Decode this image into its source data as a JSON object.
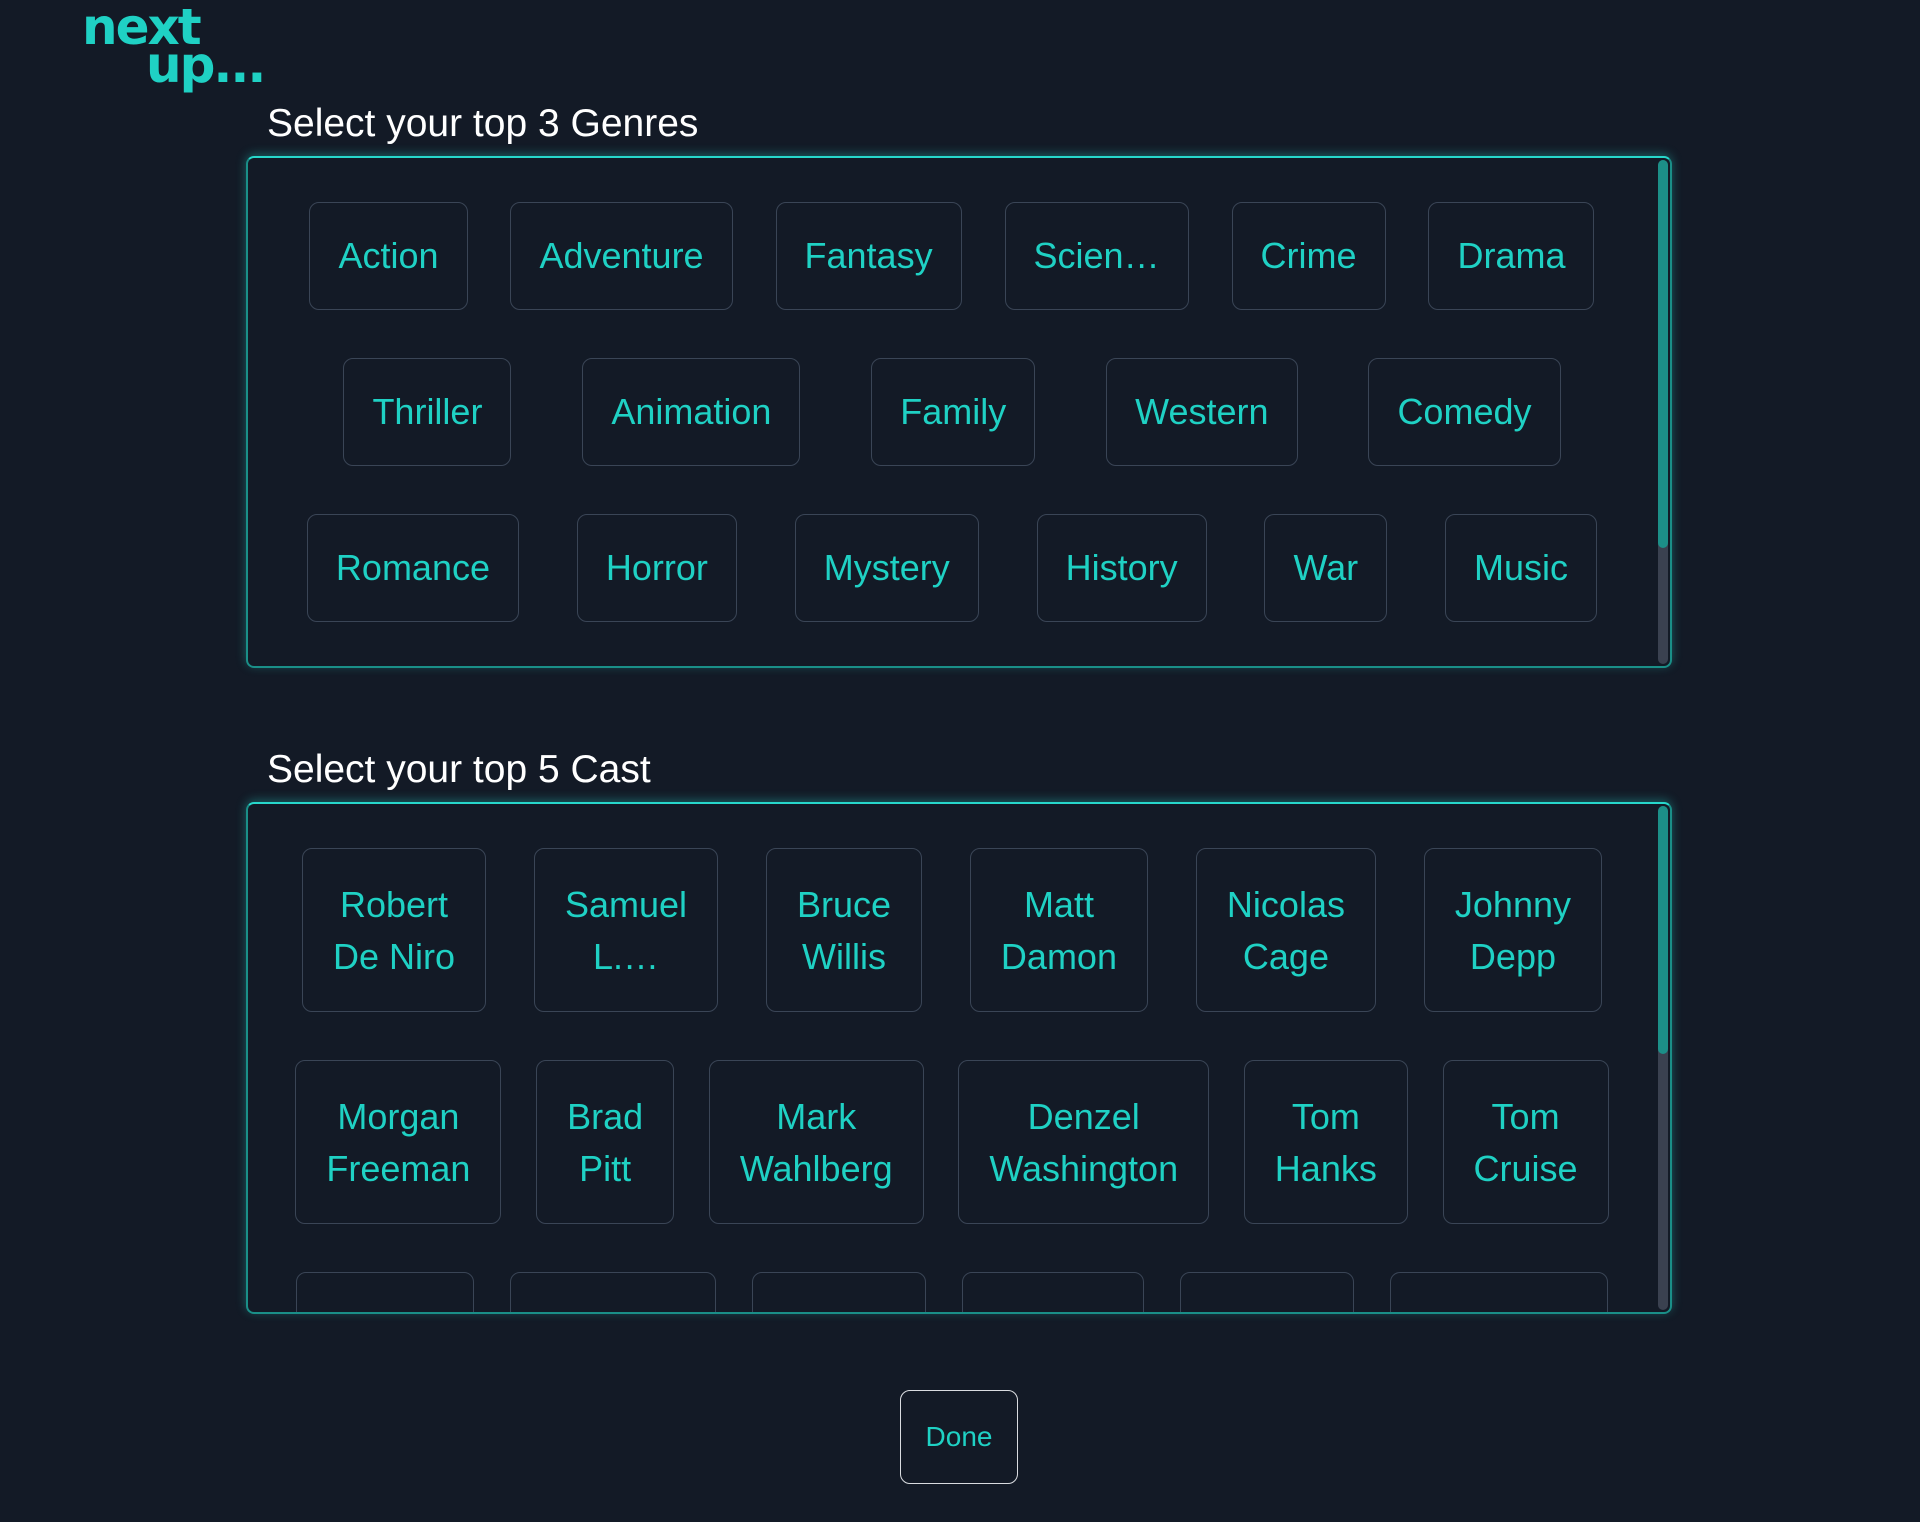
{
  "logo": {
    "line1": "next",
    "line2": "up..."
  },
  "genres": {
    "title": "Select your top 3 Genres",
    "rows": [
      [
        "Action",
        "Adventure",
        "Fantasy",
        "Scien…",
        "Crime",
        "Drama"
      ],
      [
        "Thriller",
        "Animation",
        "Family",
        "Western",
        "Comedy"
      ],
      [
        "Romance",
        "Horror",
        "Mystery",
        "History",
        "War",
        "Music"
      ]
    ]
  },
  "cast": {
    "title": "Select your top 5 Cast",
    "rows": [
      [
        "Robert\nDe Niro",
        "Samuel\nL.…",
        "Bruce\nWillis",
        "Matt\nDamon",
        "Nicolas\nCage",
        "Johnny\nDepp"
      ],
      [
        "Morgan\nFreeman",
        "Brad\nPitt",
        "Mark\nWahlberg",
        "Denzel\nWashington",
        "Tom\nHanks",
        "Tom\nCruise"
      ]
    ]
  },
  "done_label": "Done",
  "colors": {
    "background": "#131a26",
    "accent": "#1fd1c4",
    "title": "#ffffff"
  }
}
